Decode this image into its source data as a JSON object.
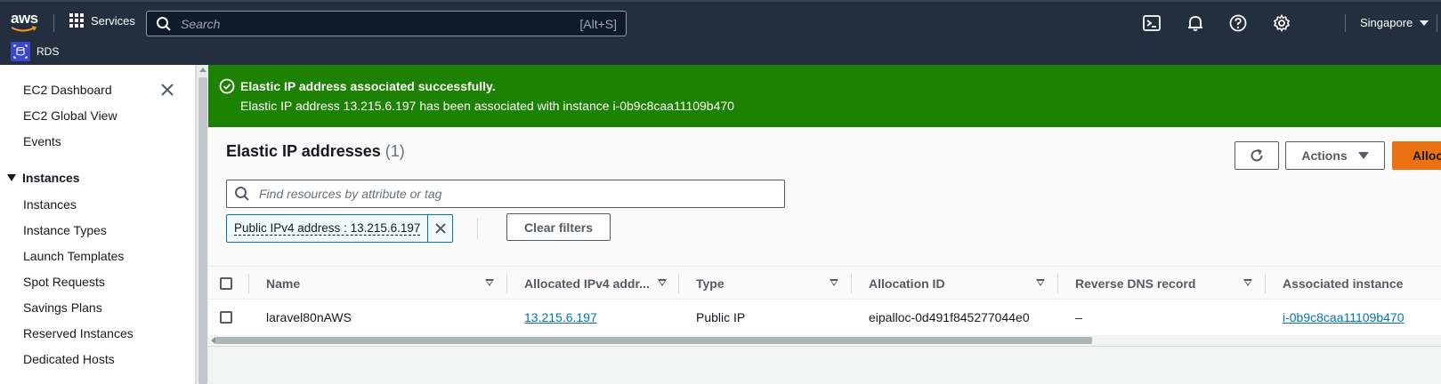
{
  "topnav": {
    "logo_text": "aws",
    "services_label": "Services",
    "search_placeholder": "Search",
    "search_shortcut": "[Alt+S]",
    "region": "Singapore",
    "icons": [
      "cloudshell-icon",
      "notifications-icon",
      "help-icon",
      "settings-icon"
    ]
  },
  "subnav": {
    "service_label": "RDS"
  },
  "sidebar": {
    "items_top": [
      "EC2 Dashboard",
      "EC2 Global View",
      "Events"
    ],
    "section": "Instances",
    "items_instances": [
      "Instances",
      "Instance Types",
      "Launch Templates",
      "Spot Requests",
      "Savings Plans",
      "Reserved Instances",
      "Dedicated Hosts"
    ]
  },
  "flash": {
    "title": "Elastic IP address associated successfully.",
    "message": "Elastic IP address 13.215.6.197 has been associated with instance i-0b9c8caa11109b470",
    "color": "#1d8102"
  },
  "panel": {
    "title": "Elastic IP addresses",
    "count": "(1)",
    "actions_label": "Actions",
    "allocate_label": "Alloc",
    "filter_placeholder": "Find resources by attribute or tag",
    "token_label": "Public IPv4 address : 13.215.6.197",
    "clear_filters_label": "Clear filters"
  },
  "table": {
    "columns": [
      "Name",
      "Allocated IPv4 addr...",
      "Type",
      "Allocation ID",
      "Reverse DNS record",
      "Associated instance"
    ],
    "rows": [
      {
        "name": "laravel80nAWS",
        "ipv4": "13.215.6.197",
        "type": "Public IP",
        "allocation_id": "eipalloc-0d491f845277044e0",
        "reverse_dns": "–",
        "instance": "i-0b9c8caa11109b470"
      }
    ]
  },
  "colors": {
    "nav_bg": "#232f3e",
    "accent_orange": "#ec7211",
    "link_blue": "#0073bb"
  }
}
